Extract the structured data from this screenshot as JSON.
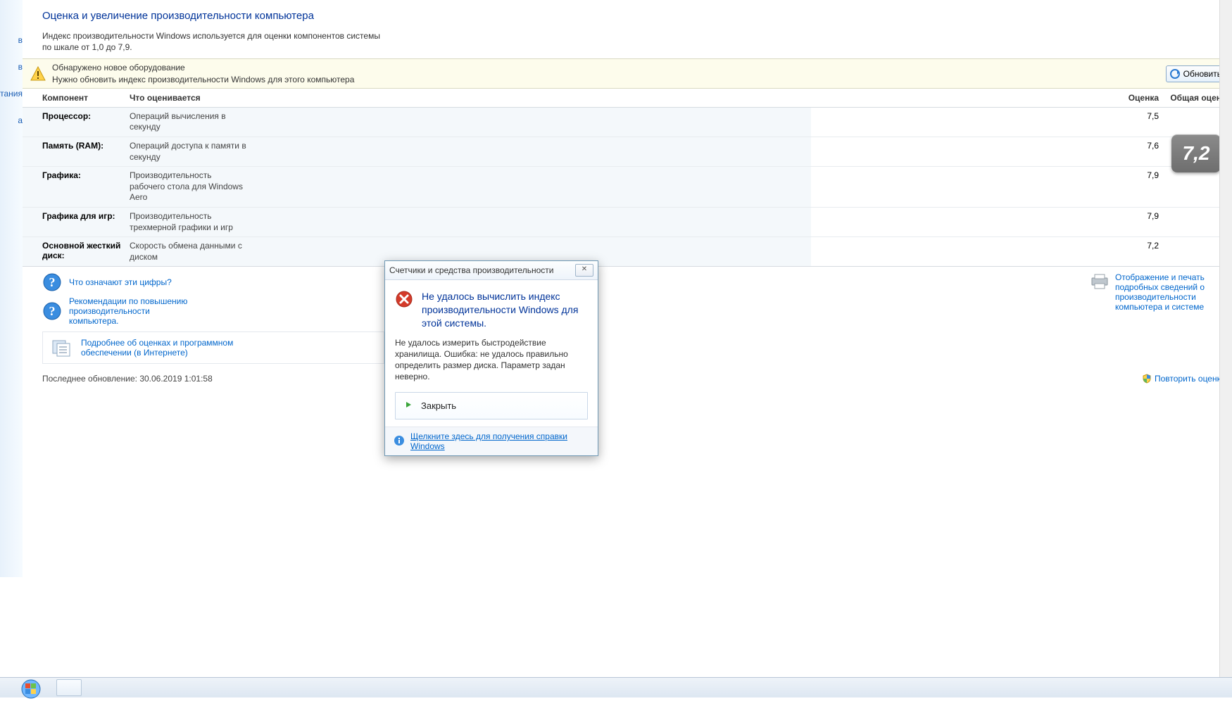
{
  "page": {
    "title": "Оценка и увеличение производительности компьютера",
    "description": "Индекс производительности Windows используется для оценки компонентов системы по шкале от 1,0 до 7,9."
  },
  "leftnav": {
    "item1": "в",
    "item2": "в",
    "item3": "тания",
    "item4": "а"
  },
  "warning": {
    "line1": "Обнаружено новое оборудование",
    "line2": "Нужно обновить индекс производительности Windows для этого компьютера",
    "refresh": "Обновить"
  },
  "headers": {
    "component": "Компонент",
    "evaluated": "Что оценивается",
    "score": "Оценка",
    "total": "Общая оценка"
  },
  "rows": [
    {
      "c": "Процессор:",
      "e": "Операций вычисления в секунду",
      "s": "7,5"
    },
    {
      "c": "Память (RAM):",
      "e": "Операций доступа к памяти в секунду",
      "s": "7,6"
    },
    {
      "c": "Графика:",
      "e": "Производительность рабочего стола для Windows Aero",
      "s": "7,9"
    },
    {
      "c": "Графика для игр:",
      "e": "Производительность трехмерной графики и игр",
      "s": "7,9"
    },
    {
      "c": "Основной жесткий диск:",
      "e": "Скорость обмена данными с диском",
      "s": "7,2"
    }
  ],
  "overall": "7,2",
  "links": {
    "what": "Что означают эти цифры?",
    "recs": "Рекомендации по повышению производительности компьютера.",
    "details": "Подробнее об оценках и программном обеспечении (в Интернете)",
    "print": "Отображение и печать подробных сведений о производительности компьютера и системе"
  },
  "footer": {
    "updated": "Последнее обновление: 30.06.2019 1:01:58",
    "retry": "Повторить оценку"
  },
  "dialog": {
    "title": "Счетчики и средства производительности",
    "headline": "Не удалось вычислить индекс производительности Windows для этой системы.",
    "message": "Не удалось измерить быстродействие хранилища. Ошибка: не удалось правильно определить размер диска. Параметр задан неверно.",
    "close": "Закрыть",
    "help": "Щелкните здесь для получения справки Windows "
  }
}
